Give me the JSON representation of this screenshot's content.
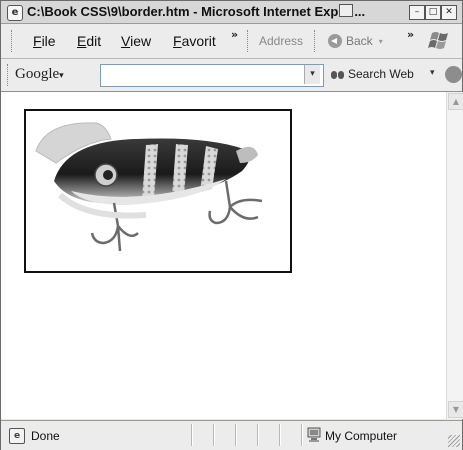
{
  "window": {
    "title": "C:\\Book CSS\\9\\border.htm - Microsoft Internet Exp",
    "title_tail": "...",
    "buttons": {
      "minimize": "–",
      "maximize": "□",
      "close": "✕"
    }
  },
  "menubar": {
    "items": [
      "File",
      "Edit",
      "View",
      "Favorit"
    ],
    "overflow": "»",
    "address_label": "Address",
    "back_label": "Back",
    "back_dropdown": "▾",
    "overflow2": "»"
  },
  "google_toolbar": {
    "logo": "Google",
    "logo_arrow": "▾",
    "search_value": "",
    "dropdown": "▾",
    "search_web_label": "Search Web",
    "more": "▾"
  },
  "content": {
    "image_alt": "fishing lure with treble hooks",
    "image_border_color": "#111111"
  },
  "scrollbar": {
    "up": "▲",
    "down": "▼"
  },
  "statusbar": {
    "status_text": "Done",
    "zone_text": "My Computer"
  },
  "colors": {
    "chrome": "#ececec",
    "titlebar": "#d7d7d7"
  }
}
